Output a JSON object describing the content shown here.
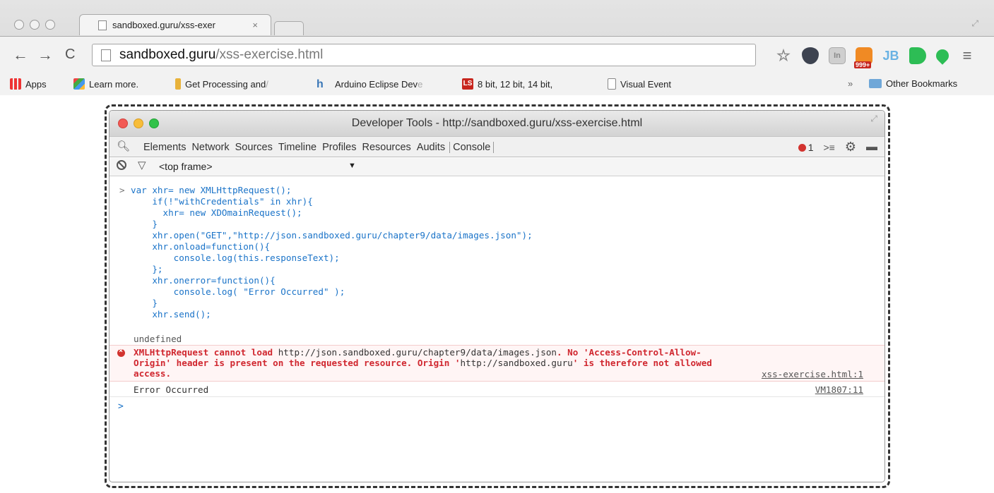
{
  "browser": {
    "tab_title": "sandboxed.guru/xss-exer",
    "tab_close": "×",
    "url_host": "sandboxed.guru",
    "url_path": "/xss-exercise.html",
    "nav": {
      "back": "←",
      "forward": "→",
      "reload": "C"
    },
    "extensions": {
      "rss_badge": "999+",
      "jb": "JB",
      "in": "In",
      "menu": "≡",
      "star": "☆"
    }
  },
  "bookmarks": [
    {
      "label": "Apps"
    },
    {
      "label": "Learn more."
    },
    {
      "label": "Get Processing and",
      "fade": "/"
    },
    {
      "label": "Arduino Eclipse Dev",
      "fade": "e"
    },
    {
      "label": "8 bit, 12 bit, 14 bit,",
      "badge": "LS"
    },
    {
      "label": "Visual Event"
    }
  ],
  "bookmarks_overflow": "»",
  "other_bookmarks": "Other Bookmarks",
  "devtools": {
    "title": "Developer Tools - http://sandboxed.guru/xss-exercise.html",
    "tabs": [
      "Elements",
      "Network",
      "Sources",
      "Timeline",
      "Profiles",
      "Resources",
      "Audits",
      "Console"
    ],
    "error_count": "1",
    "frame_select": "<top frame>",
    "frame_arrow": "▼",
    "console": {
      "prompt": ">",
      "code": [
        "var xhr= new XMLHttpRequest();",
        "    if(!\"withCredentials\" in xhr){",
        "      xhr= new XDOmainRequest();",
        "    }",
        "    xhr.open(\"GET\",\"http://json.sandboxed.guru/chapter9/data/images.json\");",
        "    xhr.onload=function(){",
        "        console.log(this.responseText);",
        "    };",
        "    xhr.onerror=function(){",
        "        console.log( \"Error Occurred\" );",
        "    }",
        "    xhr.send();"
      ],
      "result": "undefined",
      "error": {
        "part1": "XMLHttpRequest cannot load ",
        "url": "http://json.sandboxed.guru/chapter9/data/images.json",
        "part2": ". No 'Access-Control-Allow-",
        "line2": "Origin' header is present on the requested resource. Origin '",
        "origin": "http://sandboxed.guru",
        "line2_end": "' is therefore not allowed",
        "line3": "access.",
        "source": "xss-exercise.html:1"
      },
      "log": {
        "text": "Error Occurred",
        "source": "VM1807:11"
      },
      "input_prompt": ">"
    }
  },
  "colors": {
    "code_blue": "#1a73c8",
    "error_red": "#d0272f",
    "close_red": "#f25a55",
    "minimize_yellow": "#f7bd3a",
    "zoom_green": "#32c24a"
  }
}
